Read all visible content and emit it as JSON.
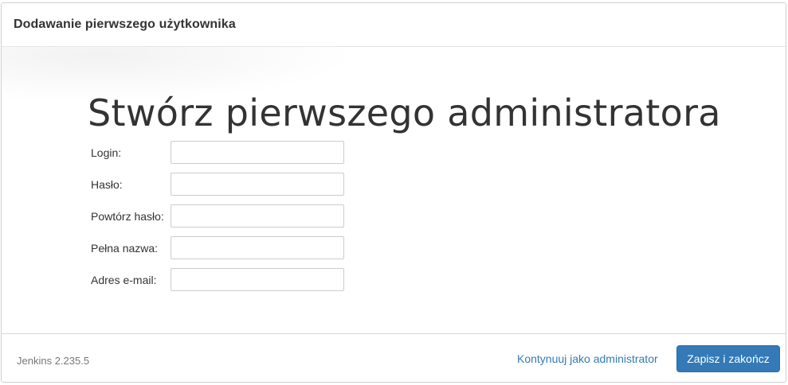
{
  "dialog": {
    "title": "Dodawanie pierwszego użytkownika"
  },
  "form": {
    "heading": "Stwórz pierwszego administratora",
    "fields": [
      {
        "label": "Login:",
        "value": ""
      },
      {
        "label": "Hasło:",
        "value": ""
      },
      {
        "label": "Powtórz hasło:",
        "value": ""
      },
      {
        "label": "Pełna nazwa:",
        "value": ""
      },
      {
        "label": "Adres e-mail:",
        "value": ""
      }
    ]
  },
  "footer": {
    "version": "Jenkins 2.235.5",
    "continue_label": "Kontynuuj jako administrator",
    "save_label": "Zapisz i zakończ"
  },
  "colors": {
    "accent": "#337ab7",
    "link": "#337ab7",
    "text": "#333333",
    "muted": "#777777"
  }
}
